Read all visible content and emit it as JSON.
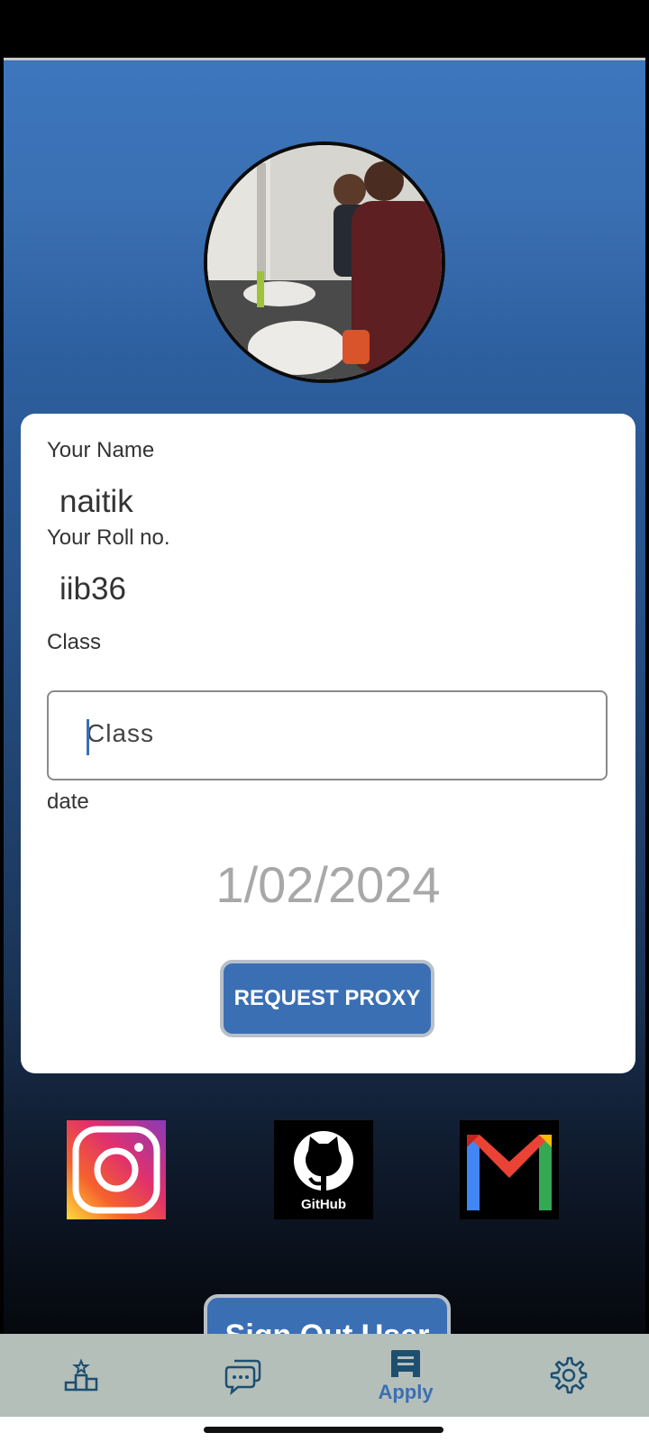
{
  "profile": {
    "name_label": "Your Name",
    "name_value": "naitik",
    "roll_label": "Your Roll no.",
    "roll_value": "iib36",
    "class_label": "Class",
    "class_input_placeholder": "Class",
    "date_label": "date",
    "date_value": "1/02/2024",
    "request_button": "REQUEST PROXY"
  },
  "social": {
    "github_text": "GitHub"
  },
  "signout_button": "Sign Out User",
  "bottom_nav": {
    "items": [
      {
        "icon": "leaderboard-icon",
        "label": ""
      },
      {
        "icon": "chat-icon",
        "label": ""
      },
      {
        "icon": "apply-icon",
        "label": "Apply"
      },
      {
        "icon": "gear-icon",
        "label": ""
      }
    ],
    "active_index": 2
  },
  "colors": {
    "accent": "#3b6fb4",
    "nav_background": "#b5bfba",
    "date_text": "#a8a8a8"
  }
}
